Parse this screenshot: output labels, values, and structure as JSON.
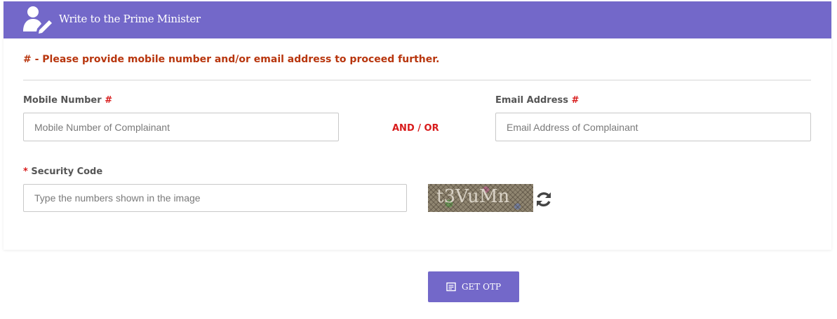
{
  "header": {
    "title": "Write to the Prime Minister",
    "icon": "user-edit-icon",
    "color": "#7368c9"
  },
  "notice": {
    "text": "# - Please provide mobile number and/or email address to proceed further."
  },
  "mobile": {
    "label": "Mobile Number",
    "required_mark": "#",
    "placeholder": "Mobile Number of Complainant",
    "value": ""
  },
  "separator": {
    "text": "AND / OR"
  },
  "email": {
    "label": "Email Address",
    "required_mark": "#",
    "placeholder": "Email Address of Complainant",
    "value": ""
  },
  "security": {
    "required_mark": "*",
    "label": "Security Code",
    "placeholder": "Type the numbers shown in the image",
    "value": "",
    "captcha_text": "t3VuMn",
    "refresh_icon": "refresh-icon"
  },
  "otp_button": {
    "label": "GET OTP",
    "icon": "list-icon"
  }
}
